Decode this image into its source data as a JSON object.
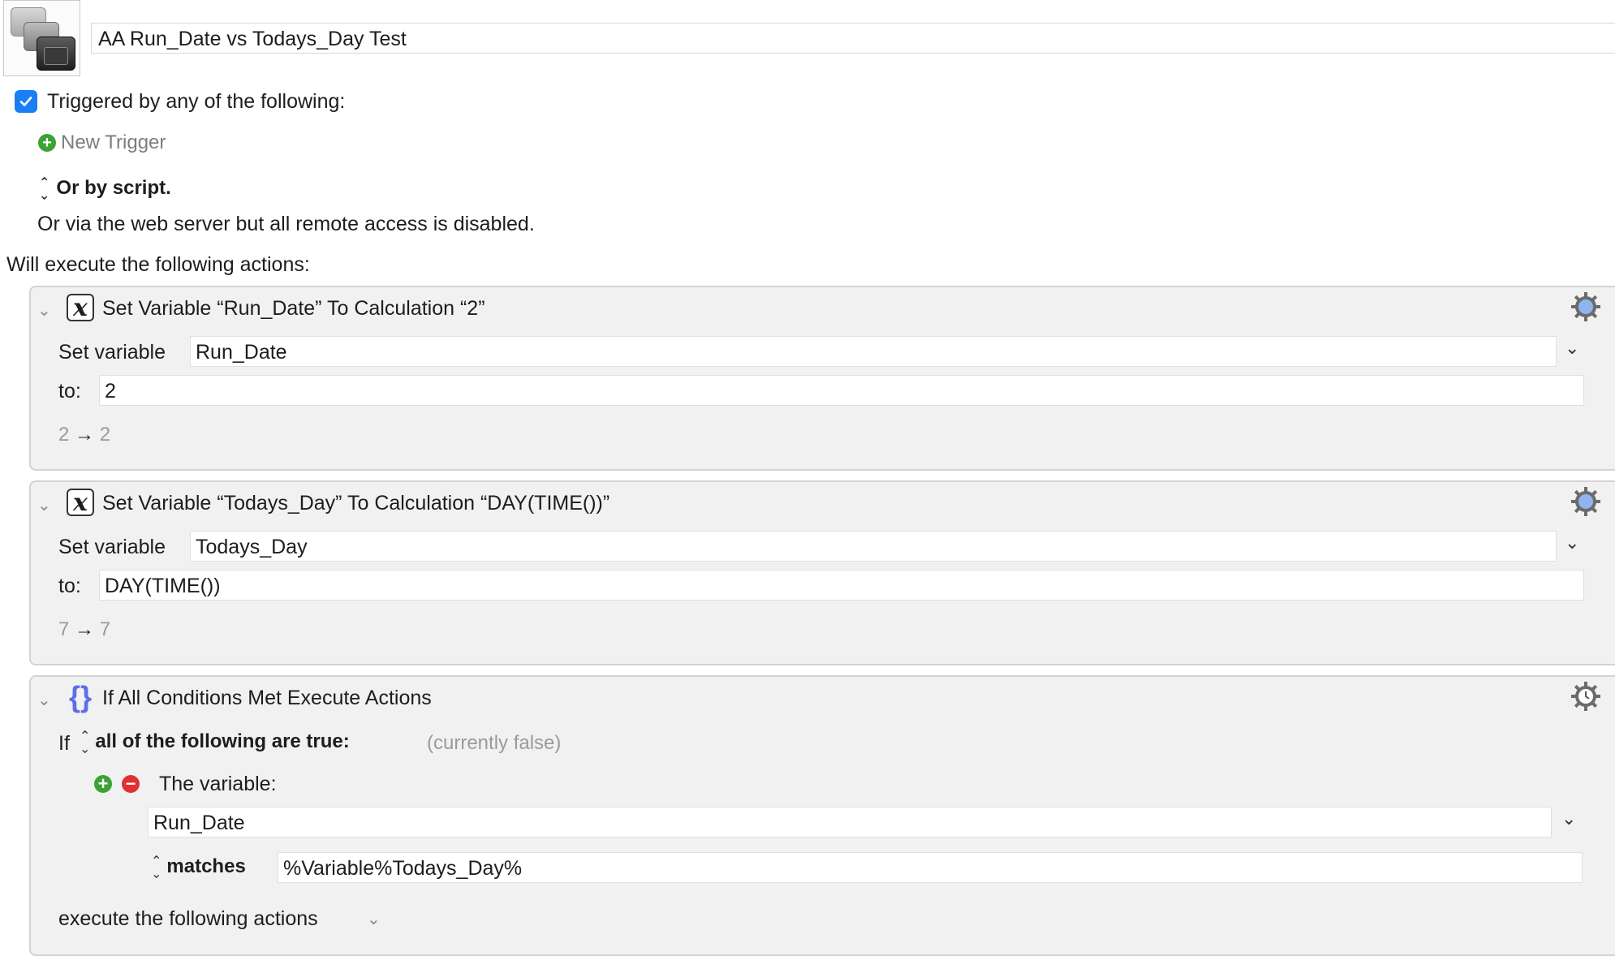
{
  "macro": {
    "name": "AA Run_Date vs Todays_Day Test",
    "icon": "macro-stack-icon"
  },
  "triggers": {
    "checked": true,
    "label": "Triggered by any of the following:",
    "new_trigger": "New Trigger",
    "or_by_script": "Or by script.",
    "web_server": "Or via the web server but all remote access is disabled."
  },
  "actions_header": "Will execute the following actions:",
  "actions": [
    {
      "title": "Set Variable “Run_Date” To Calculation “2”",
      "set_variable_label": "Set variable",
      "variable": "Run_Date",
      "to_label": "to:",
      "value": "2",
      "result_in": "2",
      "result_arrow": "→",
      "result_out": "2"
    },
    {
      "title": "Set Variable “Todays_Day” To Calculation “DAY(TIME())”",
      "set_variable_label": "Set variable",
      "variable": "Todays_Day",
      "to_label": "to:",
      "value": "DAY(TIME())",
      "result_in": "7",
      "result_arrow": "→",
      "result_out": "7"
    }
  ],
  "if_action": {
    "title": "If All Conditions Met Execute Actions",
    "if_label": "If",
    "condition_mode": "all of the following are true:",
    "status": "(currently false)",
    "condition_label": "The variable:",
    "variable": "Run_Date",
    "operator": "matches",
    "compare_value": "%Variable%Todays_Day%",
    "execute_label": "execute the following actions"
  },
  "colors": {
    "accent": "#1a7ef5",
    "add_green": "#3aa335",
    "remove_red": "#e0302f",
    "brace_blue": "#5f6ee8"
  }
}
